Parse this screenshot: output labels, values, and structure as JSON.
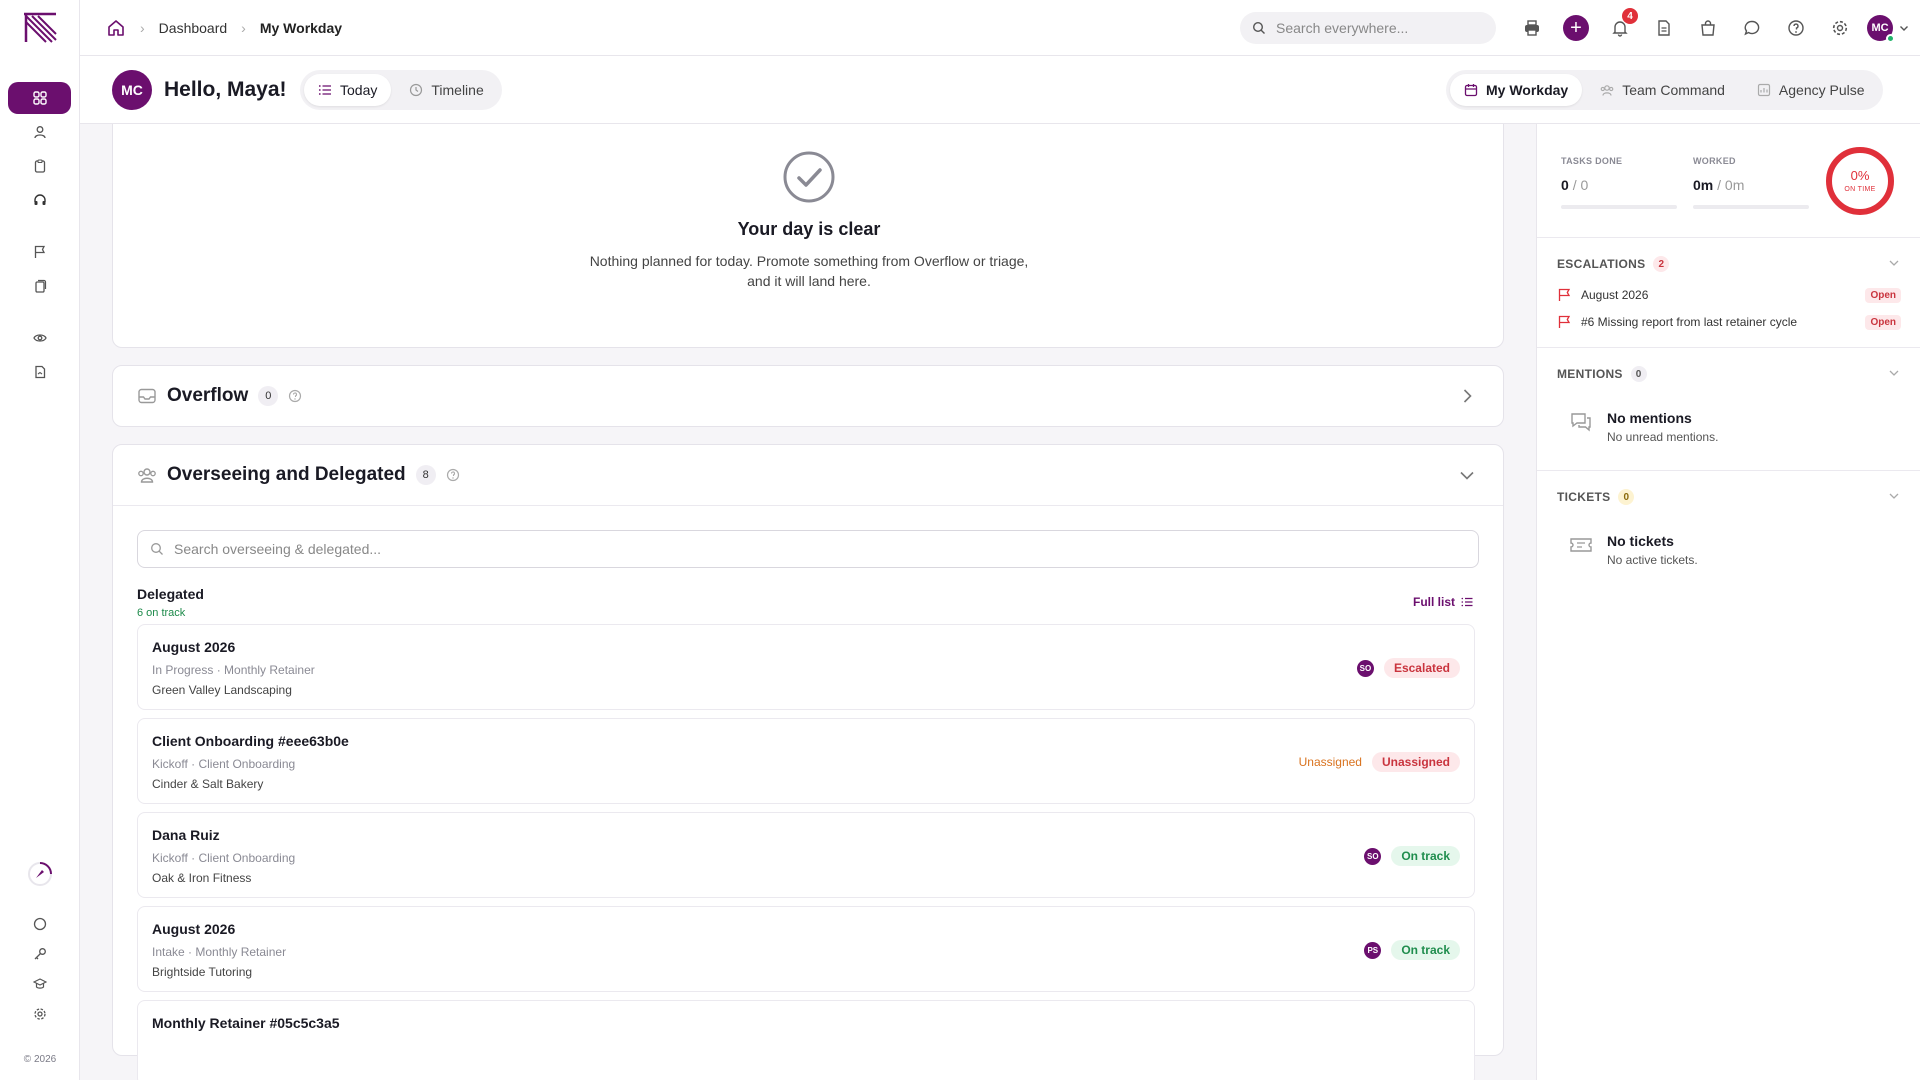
{
  "topbar": {
    "breadcrumbs": [
      "Dashboard",
      "My Workday"
    ],
    "search_placeholder": "Search everywhere...",
    "notification_count": "4",
    "user_initials": "MC"
  },
  "subhead": {
    "avatar_initials": "MC",
    "greeting": "Hello, Maya!",
    "view_tabs": [
      "Today",
      "Timeline"
    ],
    "workspace_tabs": [
      "My Workday",
      "Team Command",
      "Agency Pulse"
    ]
  },
  "clear": {
    "title": "Your day is clear",
    "line1": "Nothing planned for today. Promote something from Overflow or triage,",
    "line2": "and it will land here."
  },
  "overflow": {
    "title": "Overflow",
    "count": "0"
  },
  "overseeing": {
    "title": "Overseeing and Delegated",
    "count": "8",
    "search_placeholder": "Search overseeing & delegated...",
    "delegated_label": "Delegated",
    "delegated_sub": "6 on track",
    "full_list": "Full list",
    "items": [
      {
        "title": "August 2026",
        "meta": "In Progress · Monthly Retainer",
        "client": "Green Valley Landscaping",
        "avatar": "SO",
        "assignee_text": "",
        "status": "Escalated",
        "status_color": "red"
      },
      {
        "title": "Client Onboarding #eee63b0e",
        "meta": "Kickoff · Client Onboarding",
        "client": "Cinder & Salt Bakery",
        "avatar": "",
        "assignee_text": "Unassigned",
        "status": "Unassigned",
        "status_color": "red"
      },
      {
        "title": "Dana Ruiz",
        "meta": "Kickoff · Client Onboarding",
        "client": "Oak & Iron Fitness",
        "avatar": "SO",
        "assignee_text": "",
        "status": "On track",
        "status_color": "green"
      },
      {
        "title": "August 2026",
        "meta": "Intake · Monthly Retainer",
        "client": "Brightside Tutoring",
        "avatar": "PS",
        "assignee_text": "",
        "status": "On track",
        "status_color": "green"
      },
      {
        "title": "Monthly Retainer #05c5c3a5",
        "meta": "",
        "client": "",
        "avatar": "",
        "assignee_text": "",
        "status": "",
        "status_color": ""
      }
    ]
  },
  "stats": {
    "tasks_label": "TASKS DONE",
    "tasks_done": "0",
    "tasks_total": "/ 0",
    "worked_label": "WORKED",
    "worked_value": "0m",
    "worked_total": "/ 0m",
    "on_time_pct": "0%",
    "on_time_label": "ON TIME"
  },
  "escalations": {
    "label": "ESCALATIONS",
    "count": "2",
    "rows": [
      {
        "text": "August 2026",
        "status": "Open"
      },
      {
        "text": "#6 Missing report from last retainer cycle",
        "status": "Open"
      }
    ]
  },
  "mentions": {
    "label": "MENTIONS",
    "count": "0",
    "empty_title": "No mentions",
    "empty_desc": "No unread mentions."
  },
  "tickets": {
    "label": "TICKETS",
    "count": "0",
    "empty_title": "No tickets",
    "empty_desc": "No active tickets."
  },
  "footer": {
    "copyright": "© 2026"
  },
  "colors": {
    "brand": "#6b0f6e",
    "danger": "#e0303a",
    "success": "#1f8d4d",
    "warning": "#d9731f"
  }
}
